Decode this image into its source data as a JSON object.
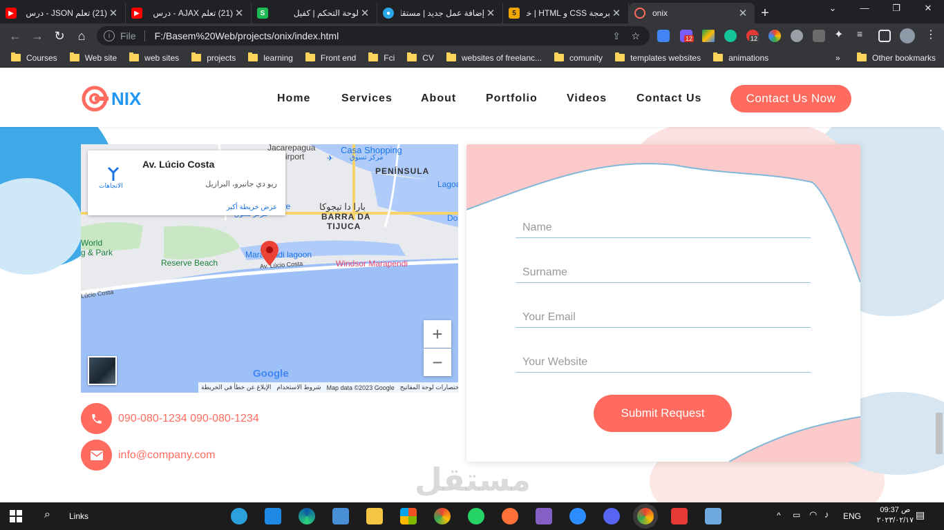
{
  "browser": {
    "tabs": [
      {
        "title": "(21) تعلم JSON - درس",
        "favicon": "youtube",
        "color": "#ff0000"
      },
      {
        "title": "(21) تعلم AJAX - درس",
        "favicon": "youtube",
        "color": "#ff0000"
      },
      {
        "title": "لوحة التحكم | كفيل",
        "favicon": "kafeel",
        "color": "#1db954"
      },
      {
        "title": "إضافة عمل جديد | مستقل",
        "favicon": "mostaql",
        "color": "#2aa7e6"
      },
      {
        "title": "برمجة CSS و HTML | خم",
        "favicon": "html5",
        "color": "#f0a500"
      },
      {
        "title": "onix",
        "favicon": "onix-logo",
        "color": "#ff6b5f",
        "active": true
      }
    ],
    "new_tab": "+",
    "window_controls": [
      "⌄",
      "—",
      "❐",
      "✕"
    ],
    "address": {
      "scheme": "File",
      "url": "F:/Basem%20Web/projects/onix/index.html"
    },
    "extension_badges": {
      "ext_a": "12",
      "ext_b": "12"
    },
    "bookmarks": [
      "Courses",
      "Web site",
      "web sites",
      "projects",
      "learning",
      "Front end",
      "Fci",
      "CV",
      "websites of freelanc...",
      "comunity",
      "templates websites",
      "animations"
    ],
    "bookmarks_overflow": "»",
    "other_bookmarks": "Other bookmarks"
  },
  "site": {
    "logo_text": "NIX",
    "nav": [
      "Home",
      "Services",
      "About",
      "Portfolio",
      "Videos",
      "Contact Us"
    ],
    "cta": "Contact Us Now",
    "map": {
      "card_title": "Av. Lúcio Costa",
      "card_subtitle": "ريو دي جانيرو، البرازيل",
      "card_link": "عرض خريطة أكبر",
      "directions_label": "الاتجاهات",
      "labels": {
        "jacarepagua": "Jacarepagua",
        "airport": "irport",
        "casa": "Casa Shopping",
        "mall_ar": "مركز تسوق",
        "peninsula": "PENÍNSULA",
        "lagoa": "Lagoa",
        "barra_ar": "بارا دا تيجوكا",
        "barra": "BARRA DA",
        "tijuca": "TIJUCA",
        "do": "Do",
        "world": "World",
        "park": "g & Park",
        "reserve": "Reserve Beach",
        "lagoon": "Marapendi lagoon",
        "avenue": "Av. Lúcio Costa",
        "windsor": "Windsor Marapendi",
        "lucio_left": "Lúcio Costa",
        "are": "are",
        "sh_ar": "مركز تسوق"
      },
      "google": "Google",
      "attribution": [
        "اختصارات لوحة المفاتيح",
        "Map data ©2023 Google",
        "شروط الاستخدام",
        "الإبلاغ عن خطأ في الخريطة"
      ],
      "zoom_in": "+",
      "zoom_out": "−"
    },
    "contact": {
      "phone": "090-080-1234  090-080-1234",
      "email": "info@company.com"
    },
    "form": {
      "name_placeholder": "Name",
      "surname_placeholder": "Surname",
      "email_placeholder": "Your Email",
      "website_placeholder": "Your Website",
      "submit": "Submit Request"
    },
    "watermark": "مستقل"
  },
  "taskbar": {
    "search_label": "Links",
    "lang": "ENG",
    "time": "09:37 ص",
    "date": "٢٠٢٣/٠٢/١٧",
    "chevron": "^"
  },
  "colors": {
    "accent": "#ff6b5f",
    "logo_blue": "#2196f3",
    "chrome_dark": "#202124",
    "chrome_mid": "#35363a"
  }
}
